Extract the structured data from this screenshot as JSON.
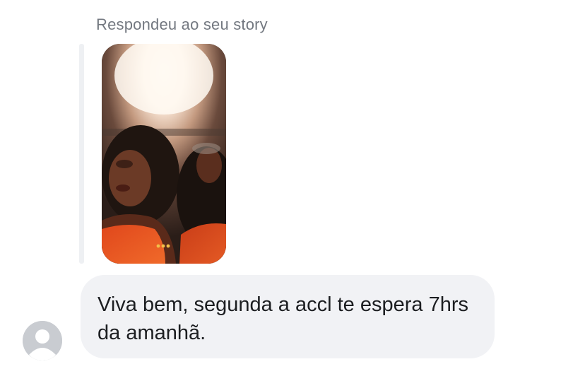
{
  "thread": {
    "reply_header": "Respondeu ao seu story",
    "message_text": "Viva bem, segunda a accl te espera 7hrs da amanhã.",
    "icons": {
      "sender_avatar": "default-avatar-icon",
      "story_preview": "story-thumbnail"
    }
  }
}
